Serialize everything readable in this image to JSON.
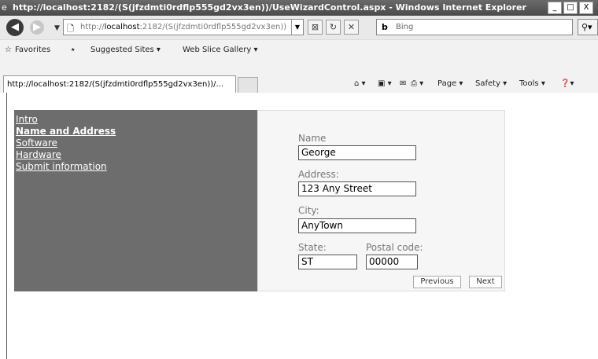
{
  "window": {
    "title": "http://localhost:2182/(S(jfzdmti0rdflp555gd2vx3en))/UseWizardControl.aspx - Windows Internet Explorer",
    "controls": [
      "_",
      "□",
      "X"
    ]
  },
  "nav": {
    "url_prefix": "http://",
    "url_host": "localhost",
    "url_rest": ":2182/(S(jfzdmti0rdflp555gd2vx3en))/UseWi",
    "search_placeholder": "Bing"
  },
  "favorites": {
    "label": "Favorites",
    "items": [
      "Suggested Sites ▾",
      "Web Slice Gallery ▾"
    ]
  },
  "tab": {
    "title": "http://localhost:2182/(S(jfzdmti0rdflp555gd2vx3en))/..."
  },
  "commandbar": {
    "page": "Page ▾",
    "safety": "Safety ▾",
    "tools": "Tools ▾"
  },
  "wizard": {
    "steps": [
      "Intro",
      "Name and Address",
      "Software",
      "Hardware",
      "Submit information"
    ],
    "current_step": "Name and Address",
    "fields": {
      "name_label": "Name",
      "name_value": "George",
      "address_label": "Address:",
      "address_value": "123 Any Street",
      "city_label": "City:",
      "city_value": "AnyTown",
      "state_label": "State:",
      "state_value": "ST",
      "postal_label": "Postal code:",
      "postal_value": "00000"
    },
    "buttons": {
      "previous": "Previous",
      "next": "Next"
    }
  }
}
